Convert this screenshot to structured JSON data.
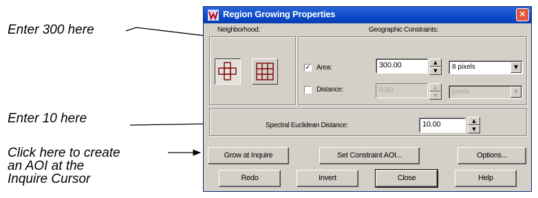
{
  "callouts": {
    "area": "Enter 300 here",
    "distance": "Enter 10 here",
    "grow_line1": "Click here to create",
    "grow_line2": "an AOI at the",
    "grow_line3": "Inquire Cursor"
  },
  "window": {
    "title": "Region Growing Properties",
    "close_glyph": "✕"
  },
  "neighborhood": {
    "label": "Neighborhood:",
    "options": [
      "4-neighbor-icon",
      "8-neighbor-icon"
    ],
    "selected": "4-neighbor-icon"
  },
  "constraints": {
    "label": "Geographic Constraints:",
    "area": {
      "label": "Area:",
      "checked": true,
      "value": "300.00",
      "unit": "8 pixels"
    },
    "distance": {
      "label": "Distance:",
      "checked": false,
      "value": "0.00",
      "unit": "pixels"
    }
  },
  "spectral": {
    "label": "Spectral Euclidean Distance:",
    "value": "10.00"
  },
  "buttons": {
    "grow": "Grow at Inquire",
    "set_aoi": "Set Constraint AOI...",
    "options": "Options...",
    "redo": "Redo",
    "invert": "Invert",
    "close": "Close",
    "help": "Help"
  },
  "colors": {
    "titlebar": "#0b49c8",
    "window_bg": "#d4d0c8",
    "close_button": "#e0563c"
  }
}
